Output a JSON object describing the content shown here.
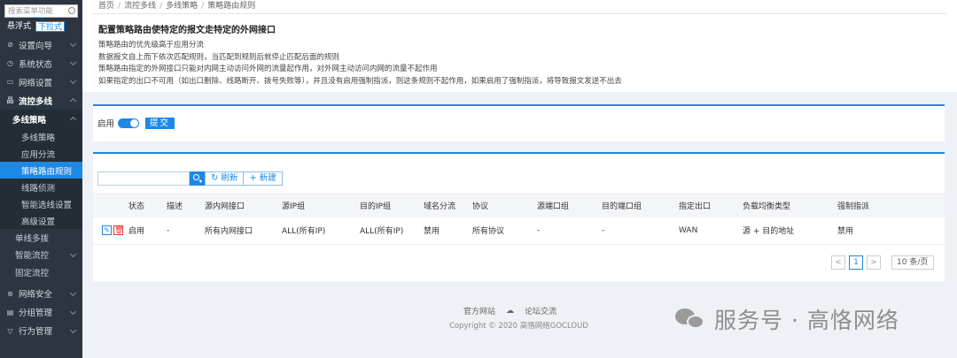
{
  "sidebar": {
    "search_placeholder": "搜索菜单功能",
    "mode_float": "悬浮式",
    "mode_dropdown": "下拉式",
    "top_items": [
      {
        "icon": "compass-icon",
        "label": "设置向导"
      },
      {
        "icon": "clock-icon",
        "label": "系统状态"
      },
      {
        "icon": "monitor-icon",
        "label": "网络设置"
      },
      {
        "icon": "flow-icon",
        "label": "流控多线"
      }
    ],
    "group_title": "多线策略",
    "group_items": [
      {
        "label": "多线策略"
      },
      {
        "label": "应用分流"
      },
      {
        "label": "策略路由规则"
      },
      {
        "label": "线路侦测"
      },
      {
        "label": "智能选线设置"
      },
      {
        "label": "高级设置"
      }
    ],
    "plain_items": [
      {
        "label": "单线多拨"
      },
      {
        "label": "智能流控"
      },
      {
        "label": "固定流控"
      }
    ],
    "bottom_items": [
      {
        "icon": "shield-icon",
        "label": "网络安全"
      },
      {
        "icon": "list-icon",
        "label": "分组管理"
      },
      {
        "icon": "funnel-icon",
        "label": "行为管理"
      }
    ]
  },
  "breadcrumb": [
    "首页",
    "流控多线",
    "多线策略",
    "策略路由规则"
  ],
  "page_title": "配置策略路由使特定的报文走特定的外网接口",
  "descriptions": [
    "策略路由的优先级高于应用分流",
    "数据报文自上而下依次匹配规则，当匹配到规则后就停止匹配后面的规则",
    "策略路由指定的外网接口只能对内网主动访问外网的流量起作用，对外网主动访问内网的流量不起作用",
    "如果指定的出口不可用（如出口删除、线路断开、拨号失败等），并且没有启用强制指派，则这条规则不起作用，如果启用了强制指派，将导致报文发送不出去"
  ],
  "enable": {
    "label": "启用",
    "submit": "提交"
  },
  "toolbar": {
    "refresh": "刷新",
    "new": "新建"
  },
  "table": {
    "headers": [
      "",
      "状态",
      "描述",
      "源内网接口",
      "源IP组",
      "目的IP组",
      "域名分流",
      "协议",
      "源端口组",
      "目的端口组",
      "指定出口",
      "负载均衡类型",
      "强制指派"
    ],
    "rows": [
      [
        "",
        "启用",
        "-",
        "所有内网接口",
        "ALL(所有IP)",
        "ALL(所有IP)",
        "禁用",
        "所有协议",
        "-",
        "-",
        "WAN",
        "源 + 目的地址",
        "禁用"
      ]
    ]
  },
  "pager": {
    "prev": "<",
    "current": "1",
    "next": ">",
    "page_size": "10 条/页"
  },
  "footer": {
    "link1": "官方网站",
    "link2": "论坛交流",
    "copyright": "Copyright © 2020 高恪网络GOCLOUD"
  },
  "watermark": "服务号 · 高恪网络",
  "colors": {
    "accent": "#1e88e5",
    "sidebar": "#2c3540",
    "danger": "#e53935"
  }
}
